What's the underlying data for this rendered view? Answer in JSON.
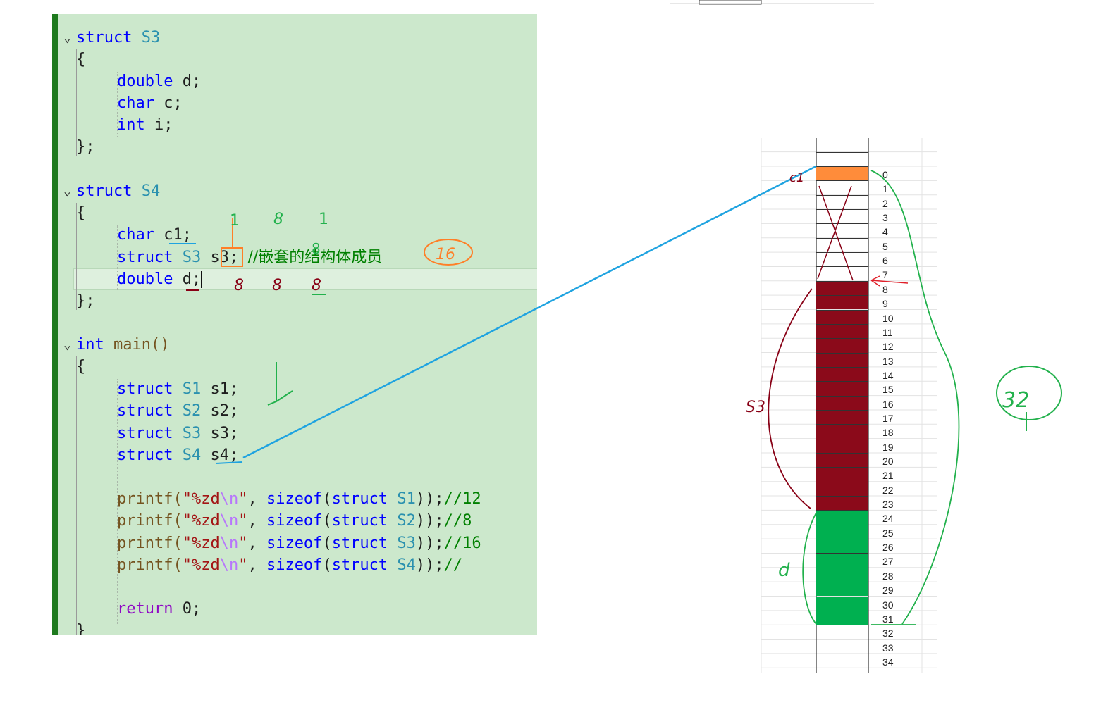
{
  "code": {
    "s3_struct": {
      "kw": "struct",
      "name": "S3",
      "open": "{",
      "close": "};",
      "members": [
        {
          "type": "double",
          "name": "d;"
        },
        {
          "type": "char",
          "name": "c;"
        },
        {
          "type": "int",
          "name": "i;"
        }
      ]
    },
    "s4_struct": {
      "kw": "struct",
      "name": "S4",
      "open": "{",
      "close": "};",
      "m1_type": "char",
      "m1_name": "c1;",
      "m2_kw": "struct",
      "m2_type": "S3",
      "m2_name": "s3;",
      "m2_comment": "//嵌套的结构体成员",
      "m3_type": "double",
      "m3_name": "d;"
    },
    "main_fn": {
      "ret": "int",
      "name": "main()",
      "open": "{",
      "decls": [
        {
          "kw": "struct",
          "type": "S1",
          "name": "s1;"
        },
        {
          "kw": "struct",
          "type": "S2",
          "name": "s2;"
        },
        {
          "kw": "struct",
          "type": "S3",
          "name": "s3;"
        },
        {
          "kw": "struct",
          "type": "S4",
          "name": "s4;"
        }
      ],
      "printfs": [
        {
          "fn": "printf(",
          "str1": "\"%zd",
          "esc": "\\n",
          "str2": "\"",
          "comma": ", ",
          "sz": "sizeof",
          "p1": "(",
          "kw": "struct",
          "sp": " ",
          "type": "S1",
          "p2": "));",
          "comment": "//12"
        },
        {
          "fn": "printf(",
          "str1": "\"%zd",
          "esc": "\\n",
          "str2": "\"",
          "comma": ", ",
          "sz": "sizeof",
          "p1": "(",
          "kw": "struct",
          "sp": " ",
          "type": "S2",
          "p2": "));",
          "comment": "//8"
        },
        {
          "fn": "printf(",
          "str1": "\"%zd",
          "esc": "\\n",
          "str2": "\"",
          "comma": ", ",
          "sz": "sizeof",
          "p1": "(",
          "kw": "struct",
          "sp": " ",
          "type": "S3",
          "p2": "));",
          "comment": "//16"
        },
        {
          "fn": "printf(",
          "str1": "\"%zd",
          "esc": "\\n",
          "str2": "\"",
          "comma": ", ",
          "sz": "sizeof",
          "p1": "(",
          "kw": "struct",
          "sp": " ",
          "type": "S4",
          "p2": "));",
          "comment": "//"
        }
      ],
      "ret_kw": "return",
      "ret_val": "0;",
      "close": "}"
    }
  },
  "memory": {
    "rows": [
      "0",
      "1",
      "2",
      "3",
      "4",
      "5",
      "6",
      "7",
      "8",
      "9",
      "10",
      "11",
      "12",
      "13",
      "14",
      "15",
      "16",
      "17",
      "18",
      "19",
      "20",
      "21",
      "22",
      "23",
      "24",
      "25",
      "26",
      "27",
      "28",
      "29",
      "30",
      "31",
      "32",
      "33",
      "34"
    ],
    "fills": {
      "c1": {
        "from": 0,
        "to": 0,
        "color": "#ff8c3a"
      },
      "s3": {
        "from": 8,
        "to": 23,
        "color": "#8b0a1a"
      },
      "d": {
        "from": 24,
        "to": 31,
        "color": "#00b050"
      }
    }
  },
  "annotations": {
    "c1": "c1",
    "s3": "S3",
    "d": "d",
    "total": "32",
    "s4_size": "16",
    "align_a": "1",
    "align_b": "8",
    "align_c": "1",
    "under_a": "8",
    "under_b": "8",
    "under_c": "8",
    "s3_mark": "8"
  },
  "colors": {
    "editor_bg": "#cce8cc",
    "annot_green": "#22b14c",
    "annot_red": "#880015",
    "annot_blue": "#1fa3e0",
    "annot_orange": "#ff7f27"
  }
}
